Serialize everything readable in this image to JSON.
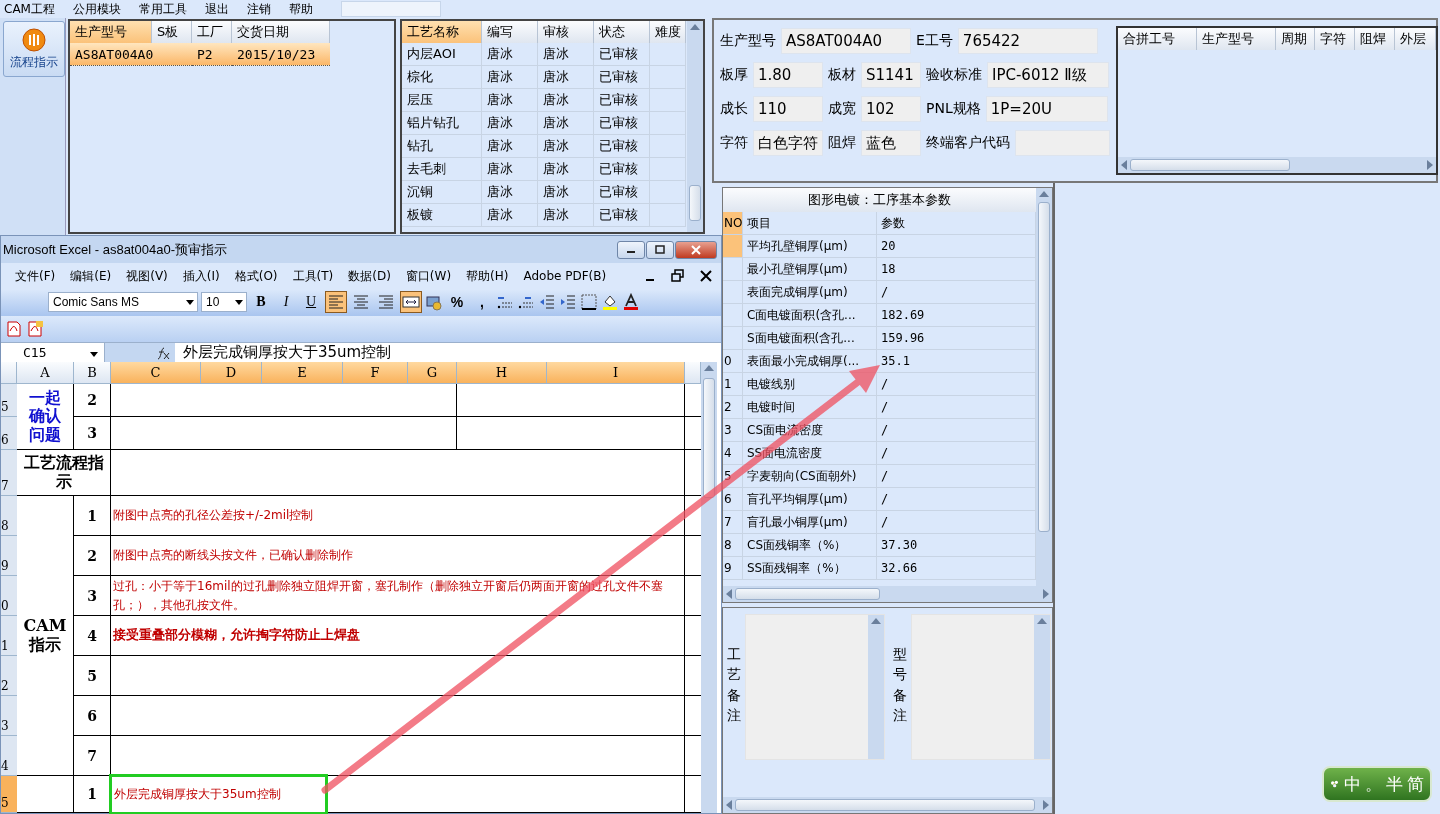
{
  "menu": [
    {
      "label": "CAM工程"
    },
    {
      "label": "公用模块"
    },
    {
      "label": "常用工具"
    },
    {
      "label": "退出"
    },
    {
      "label": "注销"
    },
    {
      "label": "帮助"
    }
  ],
  "toolbar": {
    "button": "流程指示"
  },
  "orders": {
    "columns": [
      {
        "label": "生产型号",
        "sorted": true
      },
      {
        "label": "S板",
        "sorted": false
      },
      {
        "label": "工厂",
        "sorted": false
      },
      {
        "label": "交货日期",
        "sorted": false
      }
    ],
    "rows": [
      {
        "model": "AS8AT004A0",
        "factory": "P2",
        "date": "2015/10/23",
        "selected": true
      }
    ]
  },
  "processes": {
    "columns": [
      {
        "label": "工艺名称",
        "sorted": true
      },
      {
        "label": "编写",
        "sorted": false
      },
      {
        "label": "审核",
        "sorted": false
      },
      {
        "label": "状态",
        "sorted": false
      },
      {
        "label": "难度",
        "sorted": false
      }
    ],
    "rows": [
      {
        "name": "内层AOI",
        "author": "唐冰",
        "reviewer": "唐冰",
        "status": "已审核"
      },
      {
        "name": "棕化",
        "author": "唐冰",
        "reviewer": "唐冰",
        "status": "已审核"
      },
      {
        "name": "层压",
        "author": "唐冰",
        "reviewer": "唐冰",
        "status": "已审核"
      },
      {
        "name": "铝片钻孔",
        "author": "唐冰",
        "reviewer": "唐冰",
        "status": "已审核"
      },
      {
        "name": "钻孔",
        "author": "唐冰",
        "reviewer": "唐冰",
        "status": "已审核"
      },
      {
        "name": "去毛刺",
        "author": "唐冰",
        "reviewer": "唐冰",
        "status": "已审核"
      },
      {
        "name": "沉铜",
        "author": "唐冰",
        "reviewer": "唐冰",
        "status": "已审核"
      },
      {
        "name": "板镀",
        "author": "唐冰",
        "reviewer": "唐冰",
        "status": "已审核"
      }
    ]
  },
  "info": {
    "fields": [
      {
        "label": "生产型号",
        "value": "AS8AT004A0"
      },
      {
        "label": "E工号",
        "value": "765422"
      },
      {
        "label": "板厚",
        "value": "1.80"
      },
      {
        "label": "板材",
        "value": "S1141"
      },
      {
        "label": "验收标准",
        "value": "IPC-6012 Ⅱ级"
      },
      {
        "label": "成长",
        "value": "110"
      },
      {
        "label": "成宽",
        "value": "102"
      },
      {
        "label": "PNL规格",
        "value": "1P=20U"
      },
      {
        "label": "字符",
        "value": "白色字符"
      },
      {
        "label": "阻焊",
        "value": "蓝色"
      },
      {
        "label": "终端客户代码"
      }
    ]
  },
  "merge": {
    "columns": [
      "合拼工号",
      "生产型号",
      "周期",
      "字符",
      "阻焊",
      "外层"
    ]
  },
  "params": {
    "title": "图形电镀：工序基本参数",
    "columns": [
      "NO",
      "项目",
      "参数"
    ],
    "rows": [
      {
        "item": "平均孔壁铜厚(μm)",
        "value": "20",
        "selected": true
      },
      {
        "item": "最小孔壁铜厚(μm)",
        "value": "18",
        "selected": false
      },
      {
        "item": "表面完成铜厚(μm)",
        "value": "/",
        "selected": false
      },
      {
        "item": "C面电镀面积(含孔...",
        "value": "182.69",
        "selected": false
      },
      {
        "item": "S面电镀面积(含孔...",
        "value": "159.96",
        "selected": false
      },
      {
        "no": "0",
        "item": "表面最小完成铜厚(...",
        "value": "35.1",
        "selected": false
      },
      {
        "no": "1",
        "item": "电镀线别",
        "value": "/",
        "selected": false
      },
      {
        "no": "2",
        "item": "电镀时间",
        "value": "/",
        "selected": false
      },
      {
        "no": "3",
        "item": "CS面电流密度",
        "value": "/",
        "selected": false
      },
      {
        "no": "4",
        "item": "SS面电流密度",
        "value": "/",
        "selected": false
      },
      {
        "no": "5",
        "item": "字麦朝向(CS面朝外)",
        "value": "/",
        "selected": false
      },
      {
        "no": "6",
        "item": "盲孔平均铜厚(μm)",
        "value": "/",
        "selected": false
      },
      {
        "no": "7",
        "item": "盲孔最小铜厚(μm)",
        "value": "/",
        "selected": false
      },
      {
        "no": "8",
        "item": "CS面残铜率（%）",
        "value": "37.30",
        "selected": false
      },
      {
        "no": "9",
        "item": "SS面残铜率（%）",
        "value": "32.66",
        "selected": false
      }
    ]
  },
  "notes": {
    "labels": [
      "工艺备注",
      "型号备注"
    ]
  },
  "excel": {
    "title": "Microsoft Excel - as8at004a0-预审指示",
    "menu": [
      "文件(F)",
      "编辑(E)",
      "视图(V)",
      "插入(I)",
      "格式(O)",
      "工具(T)",
      "数据(D)",
      "窗口(W)",
      "帮助(H)",
      "Adobe PDF(B)"
    ],
    "font": "Comic Sans MS",
    "size": "10",
    "format_buttons": [
      {
        "label": "B",
        "on": false
      },
      {
        "label": "I",
        "on": false
      },
      {
        "label": "U",
        "on": false
      }
    ],
    "align_buttons": [
      {
        "kind": "left",
        "on": true
      },
      {
        "kind": "center",
        "on": false
      },
      {
        "kind": "right",
        "on": false
      },
      {
        "kind": "merge",
        "on": true
      }
    ],
    "number_buttons": [
      "%",
      ","
    ],
    "name_box": "C15",
    "formula": "外层完成铜厚按大于35um控制",
    "columns": [
      {
        "label": "A",
        "selected": false
      },
      {
        "label": "B",
        "selected": false
      },
      {
        "label": "C",
        "selected": true
      },
      {
        "label": "D",
        "selected": true
      },
      {
        "label": "E",
        "selected": true
      },
      {
        "label": "F",
        "selected": true
      },
      {
        "label": "G",
        "selected": true
      },
      {
        "label": "H",
        "selected": true
      },
      {
        "label": "I",
        "selected": true
      }
    ],
    "row_headers": [
      {
        "label": "5",
        "selected": false
      },
      {
        "label": "6",
        "selected": false
      },
      {
        "label": "7",
        "selected": false
      },
      {
        "label": "8",
        "selected": false
      },
      {
        "label": "9",
        "selected": false
      },
      {
        "label": "0",
        "selected": false
      },
      {
        "label": "1",
        "selected": false
      },
      {
        "label": "2",
        "selected": false
      },
      {
        "label": "3",
        "selected": false
      },
      {
        "label": "4",
        "selected": false
      },
      {
        "label": "5",
        "selected": true
      }
    ],
    "groups": [
      {
        "kind": "question",
        "label": "一起确认问题",
        "items": [
          {
            "no": "2",
            "selected": false
          },
          {
            "no": "3",
            "selected": false
          }
        ]
      },
      {
        "kind": "flow",
        "label": "工艺流程指示"
      },
      {
        "kind": "cam",
        "label": "CAM指示",
        "items": [
          {
            "no": "1",
            "text": "附图中点亮的孔径公差按+/-2mil控制",
            "bold": false,
            "selected": false
          },
          {
            "no": "2",
            "text": "附图中点亮的断线头按文件，已确认删除制作",
            "bold": false,
            "selected": false
          },
          {
            "no": "3",
            "text": "过孔：小于等于16mil的过孔删除独立阻焊开窗，塞孔制作（删除独立开窗后仍两面开窗的过孔文件不塞孔；），其他孔按文件。",
            "bold": false,
            "selected": false
          },
          {
            "no": "4",
            "text": "接受重叠部分模糊，允许掏字符防止上焊盘",
            "bold": true,
            "selected": false
          },
          {
            "no": "5",
            "selected": false
          },
          {
            "no": "6",
            "selected": false
          },
          {
            "no": "7",
            "selected": false
          }
        ]
      },
      {
        "kind": "plain",
        "items": [
          {
            "no": "1",
            "text": "外层完成铜厚按大于35um控制",
            "bold": false,
            "selected": true
          }
        ]
      }
    ]
  },
  "ime": [
    "中",
    "。",
    "半",
    "简"
  ]
}
